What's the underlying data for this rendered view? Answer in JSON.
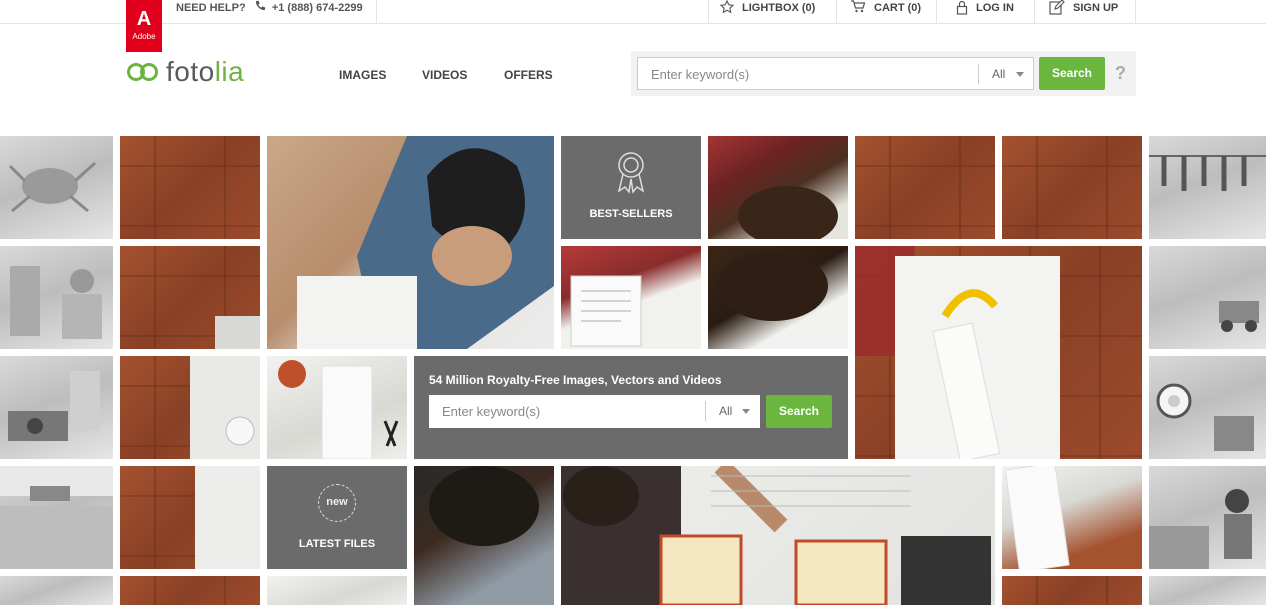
{
  "adobe": {
    "letter": "A",
    "label": "Adobe"
  },
  "topbar": {
    "help_label": "NEED HELP?",
    "phone": "+1 (888) 674-2299",
    "lightbox": "LIGHTBOX (0)",
    "cart": "CART (0)",
    "login": "LOG IN",
    "signup": "SIGN UP"
  },
  "brand": {
    "name_prefix": "foto",
    "name_suffix": "lia",
    "accent": "#6db33f"
  },
  "nav": {
    "images": "IMAGES",
    "videos": "VIDEOS",
    "offers": "OFFERS"
  },
  "search": {
    "placeholder": "Enter keyword(s)",
    "scope": "All",
    "button": "Search",
    "help": "?"
  },
  "tiles": {
    "best_sellers": "BEST-SELLERS",
    "new_badge": "new",
    "latest_files": "LATEST FILES"
  },
  "hero": {
    "title": "54 Million Royalty-Free Images, Vectors and Videos",
    "placeholder": "Enter keyword(s)",
    "scope": "All",
    "button": "Search"
  },
  "colors": {
    "search_button": "#6ab63e",
    "dark_tile": "#6b6b6b",
    "adobe_red": "#e0001b"
  },
  "icons": [
    "phone-icon",
    "star-icon",
    "cart-icon",
    "lock-icon",
    "edit-icon",
    "award-ribbon-icon",
    "new-badge-icon"
  ]
}
